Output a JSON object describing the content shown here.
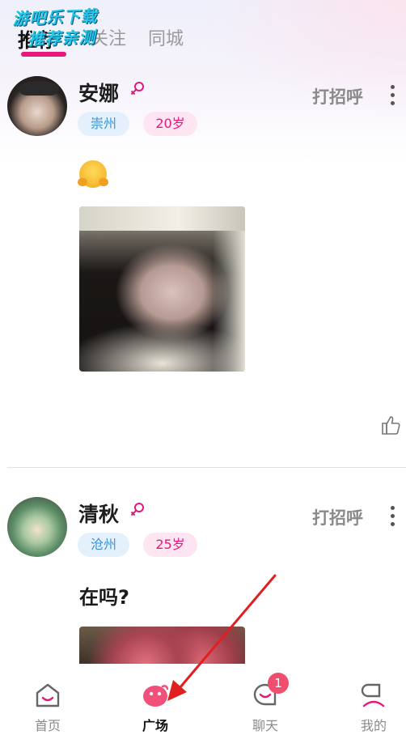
{
  "watermark": {
    "line1": "游吧乐下载",
    "line2": "推荐亲测"
  },
  "header": {
    "tabs": [
      {
        "label": "推荐",
        "active": true
      },
      {
        "label": "关注",
        "active": false
      },
      {
        "label": "同城",
        "active": false
      }
    ]
  },
  "posts": [
    {
      "username": "安娜",
      "gender": "female",
      "city": "崇州",
      "age": "20岁",
      "greet": "打招呼",
      "content_emoji": "hug-emoji",
      "has_photo": true
    },
    {
      "username": "清秋",
      "gender": "female",
      "city": "沧州",
      "age": "25岁",
      "greet": "打招呼",
      "content_text": "在吗?",
      "has_photo": true
    }
  ],
  "bottom_nav": {
    "items": [
      {
        "label": "首页",
        "icon": "home-icon",
        "active": false
      },
      {
        "label": "广场",
        "icon": "plaza-icon",
        "active": true
      },
      {
        "label": "聊天",
        "icon": "chat-icon",
        "active": false,
        "badge": "1"
      },
      {
        "label": "我的",
        "icon": "profile-icon",
        "active": false
      }
    ]
  },
  "colors": {
    "accent": "#e8177c",
    "city_tag_bg": "#e4f1fc",
    "city_tag_text": "#3a93d6",
    "age_tag_bg": "#fde6f1",
    "badge": "#ee4f6e",
    "annotation_arrow": "#e02020"
  }
}
